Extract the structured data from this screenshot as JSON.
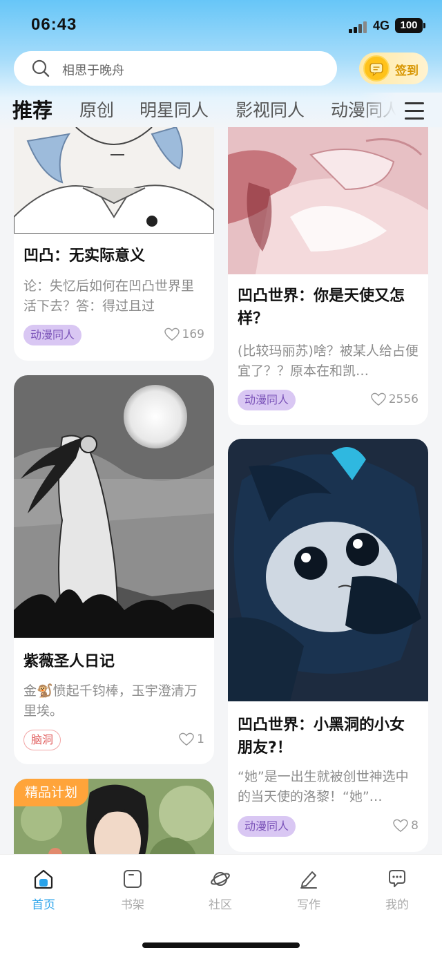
{
  "status_bar": {
    "time": "06:43",
    "network": "4G",
    "battery": "100"
  },
  "search": {
    "placeholder": "相思于晚舟"
  },
  "checkin": {
    "label": "签到"
  },
  "tabs": [
    {
      "label": "推荐",
      "active": true
    },
    {
      "label": "原创"
    },
    {
      "label": "明星同人"
    },
    {
      "label": "影视同人"
    },
    {
      "label": "动漫同人"
    }
  ],
  "feed": {
    "left": [
      {
        "title": "凹凸：无实际意义",
        "desc": "论：失忆后如何在凹凸世界里活下去？答：得过且过",
        "tag": "动漫同人",
        "likes": "169"
      },
      {
        "title": "紫薇圣人日记",
        "desc": "金🐒愤起千钧棒，玉宇澄清万里埃。",
        "tag": "脑洞",
        "likes": "1"
      },
      {
        "badge": "精品计划"
      }
    ],
    "right": [
      {
        "title": "凹凸世界：你是天使又怎样？",
        "desc": "(比较玛丽苏)啥？被某人给占便宜了？？原本在和凯…",
        "tag": "动漫同人",
        "likes": "2556"
      },
      {
        "title": "凹凸世界：小黑洞的小女朋友?！",
        "desc": "“她”是一出生就被创世神选中的当天使的洛黎！“她”…",
        "tag": "动漫同人",
        "likes": "8"
      }
    ]
  },
  "bottom_nav": [
    {
      "label": "首页",
      "icon": "home-icon",
      "active": true
    },
    {
      "label": "书架",
      "icon": "bookshelf-icon"
    },
    {
      "label": "社区",
      "icon": "planet-icon"
    },
    {
      "label": "写作",
      "icon": "pen-icon"
    },
    {
      "label": "我的",
      "icon": "chat-bubble-icon"
    }
  ],
  "colors": {
    "accent": "#2aa3ea",
    "tag_purple": "#d9c7f3",
    "premium": "#ffa43a"
  }
}
